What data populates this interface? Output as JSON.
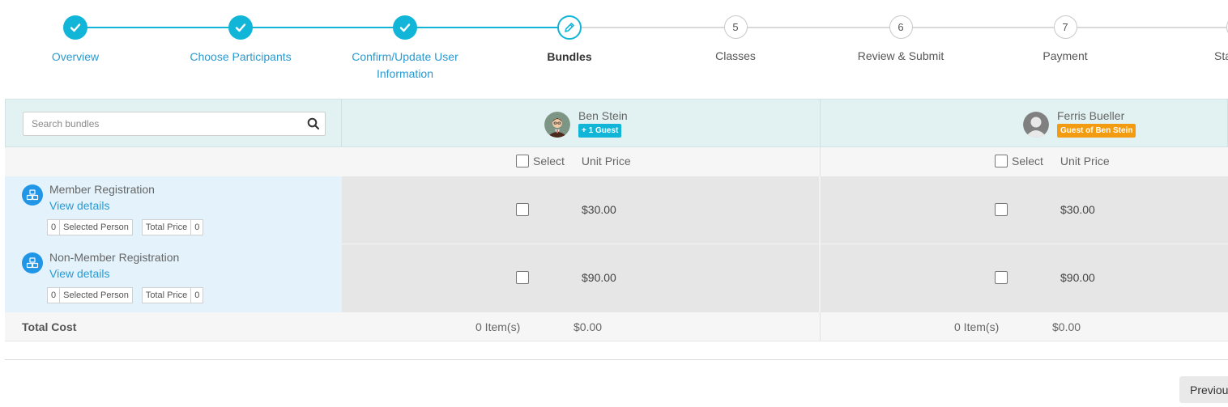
{
  "stepper": {
    "steps": [
      {
        "label": "Overview",
        "status": "done",
        "number": ""
      },
      {
        "label": "Choose Participants",
        "status": "done",
        "number": ""
      },
      {
        "label": "Confirm/Update User Information",
        "status": "done",
        "number": ""
      },
      {
        "label": "Bundles",
        "status": "current",
        "number": ""
      },
      {
        "label": "Classes",
        "status": "todo",
        "number": "5"
      },
      {
        "label": "Review & Submit",
        "status": "todo",
        "number": "6"
      },
      {
        "label": "Payment",
        "status": "todo",
        "number": "7"
      },
      {
        "label": "Sta",
        "status": "todo",
        "number": ""
      }
    ]
  },
  "search": {
    "placeholder": "Search bundles",
    "value": ""
  },
  "participants": [
    {
      "name": "Ben Stein",
      "badge": "+ 1 Guest"
    },
    {
      "name": "Ferris Bueller",
      "badge": "Guest of Ben Stein"
    }
  ],
  "columns": {
    "select_label": "Select",
    "unit_price_label": "Unit Price"
  },
  "bundles": [
    {
      "name": "Member Registration",
      "view_details": "View details",
      "selected_count": "0",
      "selected_label": "Selected Person",
      "total_price_label": "Total Price",
      "total_price": "0",
      "prices": [
        "$30.00",
        "$30.00"
      ]
    },
    {
      "name": "Non-Member Registration",
      "view_details": "View details",
      "selected_count": "0",
      "selected_label": "Selected Person",
      "total_price_label": "Total Price",
      "total_price": "0",
      "prices": [
        "$90.00",
        "$90.00"
      ]
    }
  ],
  "totals": {
    "label": "Total Cost",
    "per_participant": [
      {
        "items": "0 Item(s)",
        "cost": "$0.00"
      },
      {
        "items": "0 Item(s)",
        "cost": "$0.00"
      }
    ]
  },
  "footer": {
    "previous_label": "Previous"
  },
  "colors": {
    "accent": "#11b5d8",
    "link": "#2a9ad1",
    "guest_badge": "#f39c12",
    "bundle_icon": "#2196e6"
  }
}
